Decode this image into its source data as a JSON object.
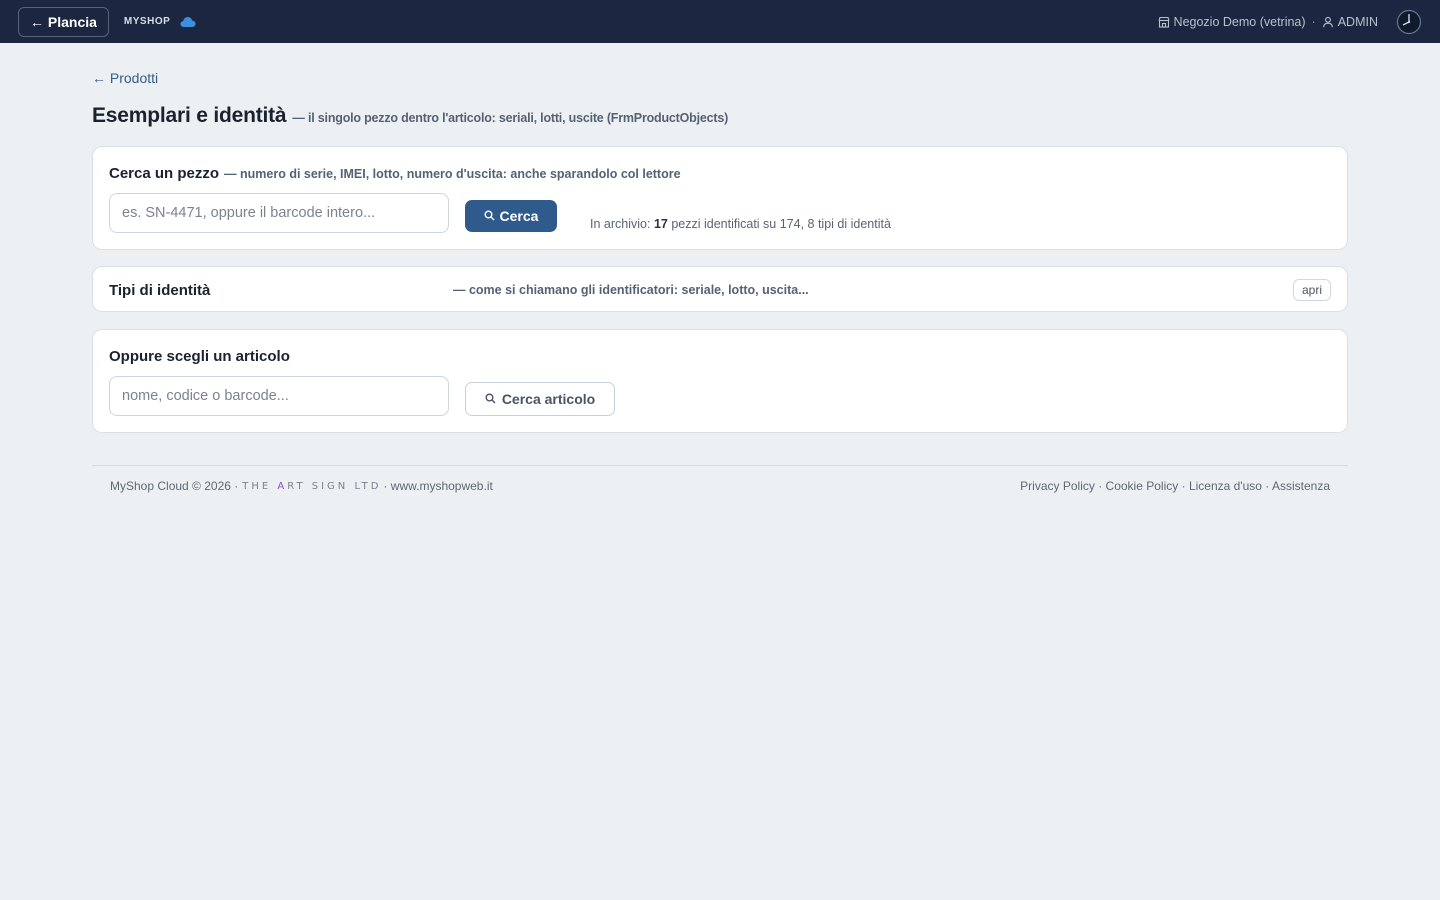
{
  "topbar": {
    "back_label": "← Plancia",
    "brand": "MYSHOP",
    "store": "Negozio Demo (vetrina)",
    "separator": "·",
    "user": "ADMIN"
  },
  "breadcrumb": "← Prodotti",
  "page": {
    "title": "Esemplari e identità",
    "subtitle": "— il singolo pezzo dentro l'articolo: seriali, lotti, uscite (FrmProductObjects)"
  },
  "search_card": {
    "title": "Cerca un pezzo",
    "hint": "— numero di serie, IMEI, lotto, numero d'uscita: anche sparandolo col lettore",
    "placeholder": "es. SN-4471, oppure il barcode intero...",
    "button": "Cerca",
    "archive_prefix": "In archivio:",
    "archive_count": "17",
    "archive_suffix": "pezzi identificati su 174, 8 tipi di identità"
  },
  "types_card": {
    "title": "Tipi di identità",
    "hint": "— come si chiamano gli identificatori: seriale, lotto, uscita...",
    "button": "apri"
  },
  "article_card": {
    "title": "Oppure scegli un articolo",
    "placeholder": "nome, codice o barcode...",
    "button": "Cerca articolo"
  },
  "footer": {
    "copyright": "MyShop Cloud © 2026 ·",
    "artsign_the": "THE",
    "artsign_a": "A",
    "artsign_rest": "RT SIGN LTD",
    "website": "· www.myshopweb.it",
    "links": [
      "Privacy Policy",
      "Cookie Policy",
      "Licenza d'uso",
      "Assistenza"
    ],
    "link_separator": "·"
  },
  "colors": {
    "topbar_bg": "#1b2740",
    "page_bg": "#edf0f3",
    "primary_button": "#2f5b8c",
    "accent_link": "#365c88",
    "cloud_icon": "#3d8fe0",
    "artsign_accent": "#8b4fd0"
  },
  "icons": [
    "cloud-icon",
    "store-icon",
    "user-icon",
    "clock-icon",
    "search-icon"
  ]
}
